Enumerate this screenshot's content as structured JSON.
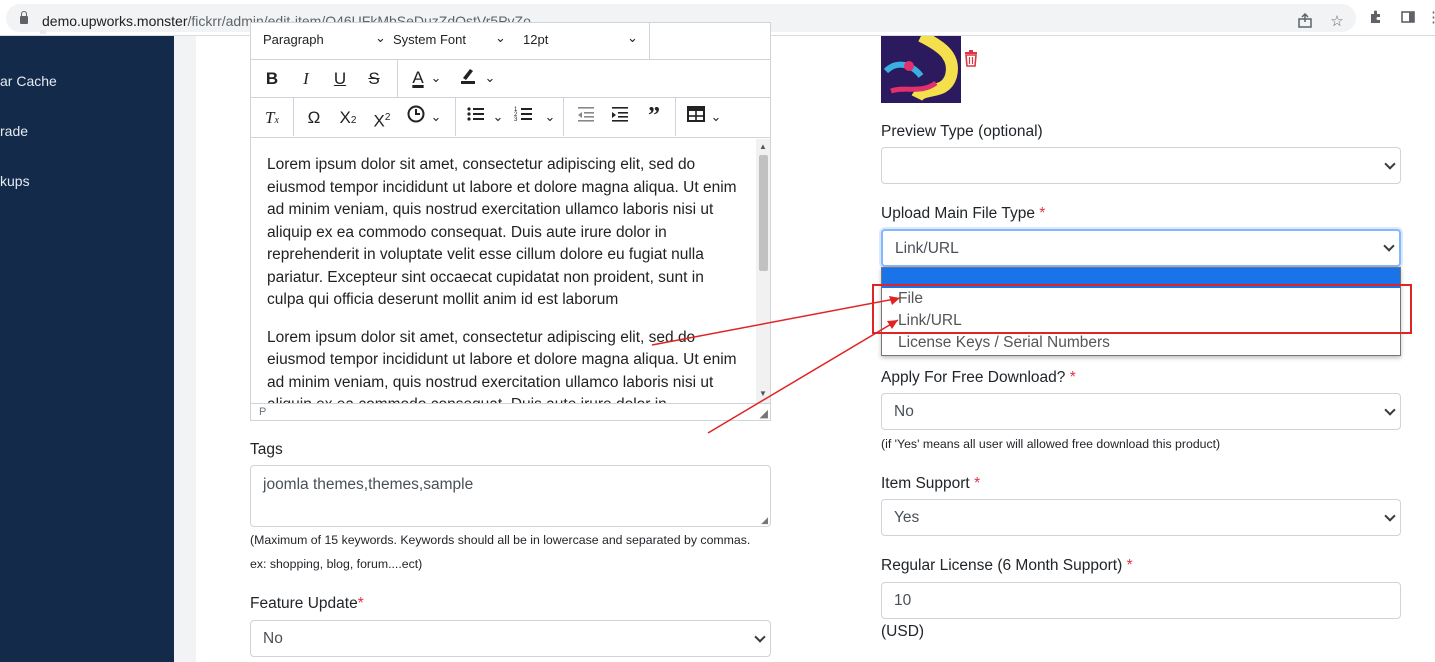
{
  "browser": {
    "url_host": "demo.upworks.monster",
    "url_path": "/fickrr/admin/edit-item/O46UFkMbSeDuzZdOstVr5PvZo"
  },
  "sidebar": {
    "items": [
      {
        "label": "ar Cache"
      },
      {
        "label": "rade"
      },
      {
        "label": "kups"
      }
    ]
  },
  "editor": {
    "block_format": "Paragraph",
    "font_family": "System Font",
    "font_size": "12pt",
    "paragraphs": [
      "Lorem ipsum dolor sit amet, consectetur adipiscing elit, sed do eiusmod tempor incididunt ut labore et dolore magna aliqua. Ut enim ad minim veniam, quis nostrud exercitation ullamco laboris nisi ut aliquip ex ea commodo consequat. Duis aute irure dolor in reprehenderit in voluptate velit esse cillum dolore eu fugiat nulla pariatur. Excepteur sint occaecat cupidatat non proident, sunt in culpa qui officia deserunt mollit anim id est laborum",
      "Lorem ipsum dolor sit amet, consectetur adipiscing elit, sed do eiusmod tempor incididunt ut labore et dolore magna aliqua. Ut enim ad minim veniam, quis nostrud exercitation ullamco laboris nisi ut aliquip ex ea commodo consequat. Duis aute irure dolor in"
    ],
    "status_path": "P"
  },
  "tags": {
    "label": "Tags",
    "value": "joomla themes,themes,sample",
    "hint_line1": "(Maximum of 15 keywords. Keywords should all be in lowercase and separated by commas.",
    "hint_line2": "ex: shopping, blog, forum....ect)"
  },
  "feature_update": {
    "label": "Feature Update",
    "required": "*",
    "value": "No"
  },
  "preview_type": {
    "label": "Preview Type (optional)",
    "value": ""
  },
  "upload_type": {
    "label": "Upload Main File Type",
    "required": "*",
    "value": "Link/URL",
    "options": [
      "",
      "File",
      "Link/URL",
      "License Keys / Serial Numbers"
    ],
    "selected_highlight_color": "#1a73e8"
  },
  "free_download": {
    "label": "Apply For Free Download?",
    "required": "*",
    "value": "No",
    "hint": "(if 'Yes' means all user will allowed free download this product)"
  },
  "item_support": {
    "label": "Item Support",
    "required": "*",
    "value": "Yes"
  },
  "regular_license": {
    "label": "Regular License (6 Month Support)",
    "required": "*",
    "value": "10",
    "unit": "(USD)"
  },
  "annotation_color": "#e02424"
}
